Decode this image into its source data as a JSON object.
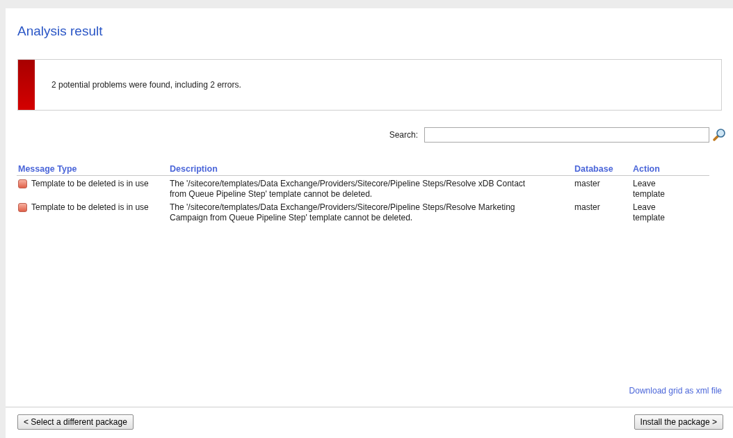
{
  "title": "Analysis result",
  "alert": {
    "kind": "error",
    "message": "2 potential problems were found, including 2 errors."
  },
  "search": {
    "label": "Search:"
  },
  "table": {
    "columns": [
      "Message Type",
      "Description",
      "Database",
      "Action"
    ],
    "rows": [
      {
        "kind": "error",
        "message_type": "Template to be deleted is in use",
        "description": "The '/sitecore/templates/Data Exchange/Providers/Sitecore/Pipeline Steps/Resolve xDB Contact from Queue Pipeline Step' template cannot be deleted.",
        "database": "master",
        "action": "Leave template"
      },
      {
        "kind": "error",
        "message_type": "Template to be deleted is in use",
        "description": "The '/sitecore/templates/Data Exchange/Providers/Sitecore/Pipeline Steps/Resolve Marketing Campaign from Queue Pipeline Step' template cannot be deleted.",
        "database": "master",
        "action": "Leave template"
      }
    ]
  },
  "download_link": "Download grid as xml file",
  "buttons": {
    "back": "< Select a different package",
    "next": "Install the package >"
  }
}
